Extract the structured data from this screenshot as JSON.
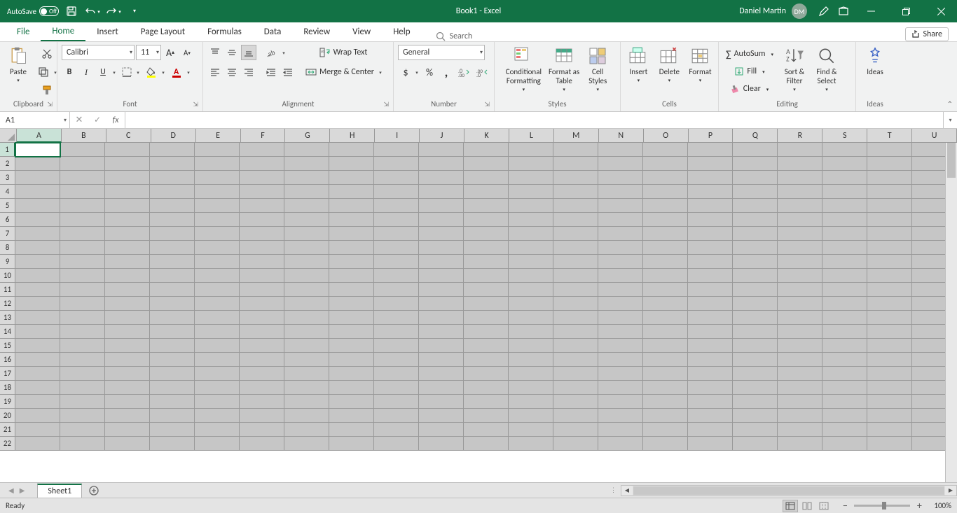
{
  "titlebar": {
    "autosave_label": "AutoSave",
    "autosave_state": "Off",
    "doc_title": "Book1 - Excel",
    "user_name": "Daniel Martin",
    "user_initials": "DM"
  },
  "tabs": {
    "file": "File",
    "items": [
      "Home",
      "Insert",
      "Page Layout",
      "Formulas",
      "Data",
      "Review",
      "View",
      "Help"
    ],
    "active": "Home",
    "search_placeholder": "Search",
    "share": "Share"
  },
  "ribbon": {
    "clipboard": {
      "paste": "Paste",
      "label": "Clipboard"
    },
    "font": {
      "name": "Calibri",
      "size": "11",
      "label": "Font"
    },
    "alignment": {
      "wrap": "Wrap Text",
      "merge": "Merge & Center",
      "label": "Alignment"
    },
    "number": {
      "format": "General",
      "label": "Number"
    },
    "styles": {
      "conditional": "Conditional\nFormatting",
      "fat": "Format as\nTable",
      "cell": "Cell\nStyles",
      "label": "Styles"
    },
    "cells": {
      "insert": "Insert",
      "delete": "Delete",
      "format": "Format",
      "label": "Cells"
    },
    "editing": {
      "autosum": "AutoSum",
      "fill": "Fill",
      "clear": "Clear",
      "sort": "Sort &\nFilter",
      "find": "Find &\nSelect",
      "label": "Editing"
    },
    "ideas": {
      "ideas": "Ideas",
      "label": "Ideas"
    }
  },
  "formula": {
    "name_box": "A1",
    "fx": "fx",
    "value": ""
  },
  "grid": {
    "columns": [
      "A",
      "B",
      "C",
      "D",
      "E",
      "F",
      "G",
      "H",
      "I",
      "J",
      "K",
      "L",
      "M",
      "N",
      "O",
      "P",
      "Q",
      "R",
      "S",
      "T",
      "U"
    ],
    "row_count": 22,
    "active_col": "A",
    "active_row": 1
  },
  "sheets": {
    "active": "Sheet1"
  },
  "status": {
    "ready": "Ready",
    "zoom": "100%"
  }
}
